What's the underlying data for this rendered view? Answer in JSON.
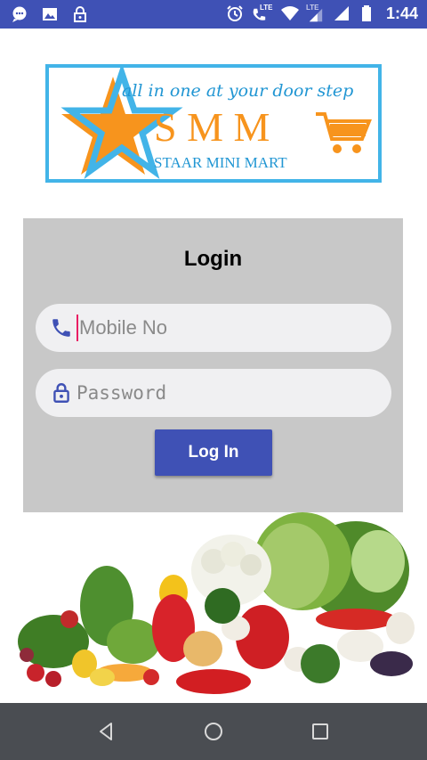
{
  "status_bar": {
    "time": "1:44",
    "lte_labels": [
      "LTE",
      "LTE"
    ],
    "icons": [
      "chat-notification-icon",
      "image-icon",
      "lock-icon",
      "alarm-icon",
      "volte-call-icon",
      "wifi-icon",
      "signal-icon",
      "signal-icon",
      "battery-icon"
    ]
  },
  "logo": {
    "tagline": "all in one at your door step",
    "initials": "S M M",
    "name": "STAAR MINI MART"
  },
  "login": {
    "title": "Login",
    "mobile_placeholder": "Mobile No",
    "password_placeholder": "Password",
    "button_label": "Log In"
  },
  "colors": {
    "primary": "#3f51b5",
    "panel_bg": "#c8c8c8",
    "logo_border": "#42b4e8",
    "logo_orange": "#f7941d",
    "cursor": "#e91e63"
  },
  "nav_bar": {
    "buttons": [
      "back-icon",
      "home-icon",
      "recent-apps-icon"
    ]
  }
}
